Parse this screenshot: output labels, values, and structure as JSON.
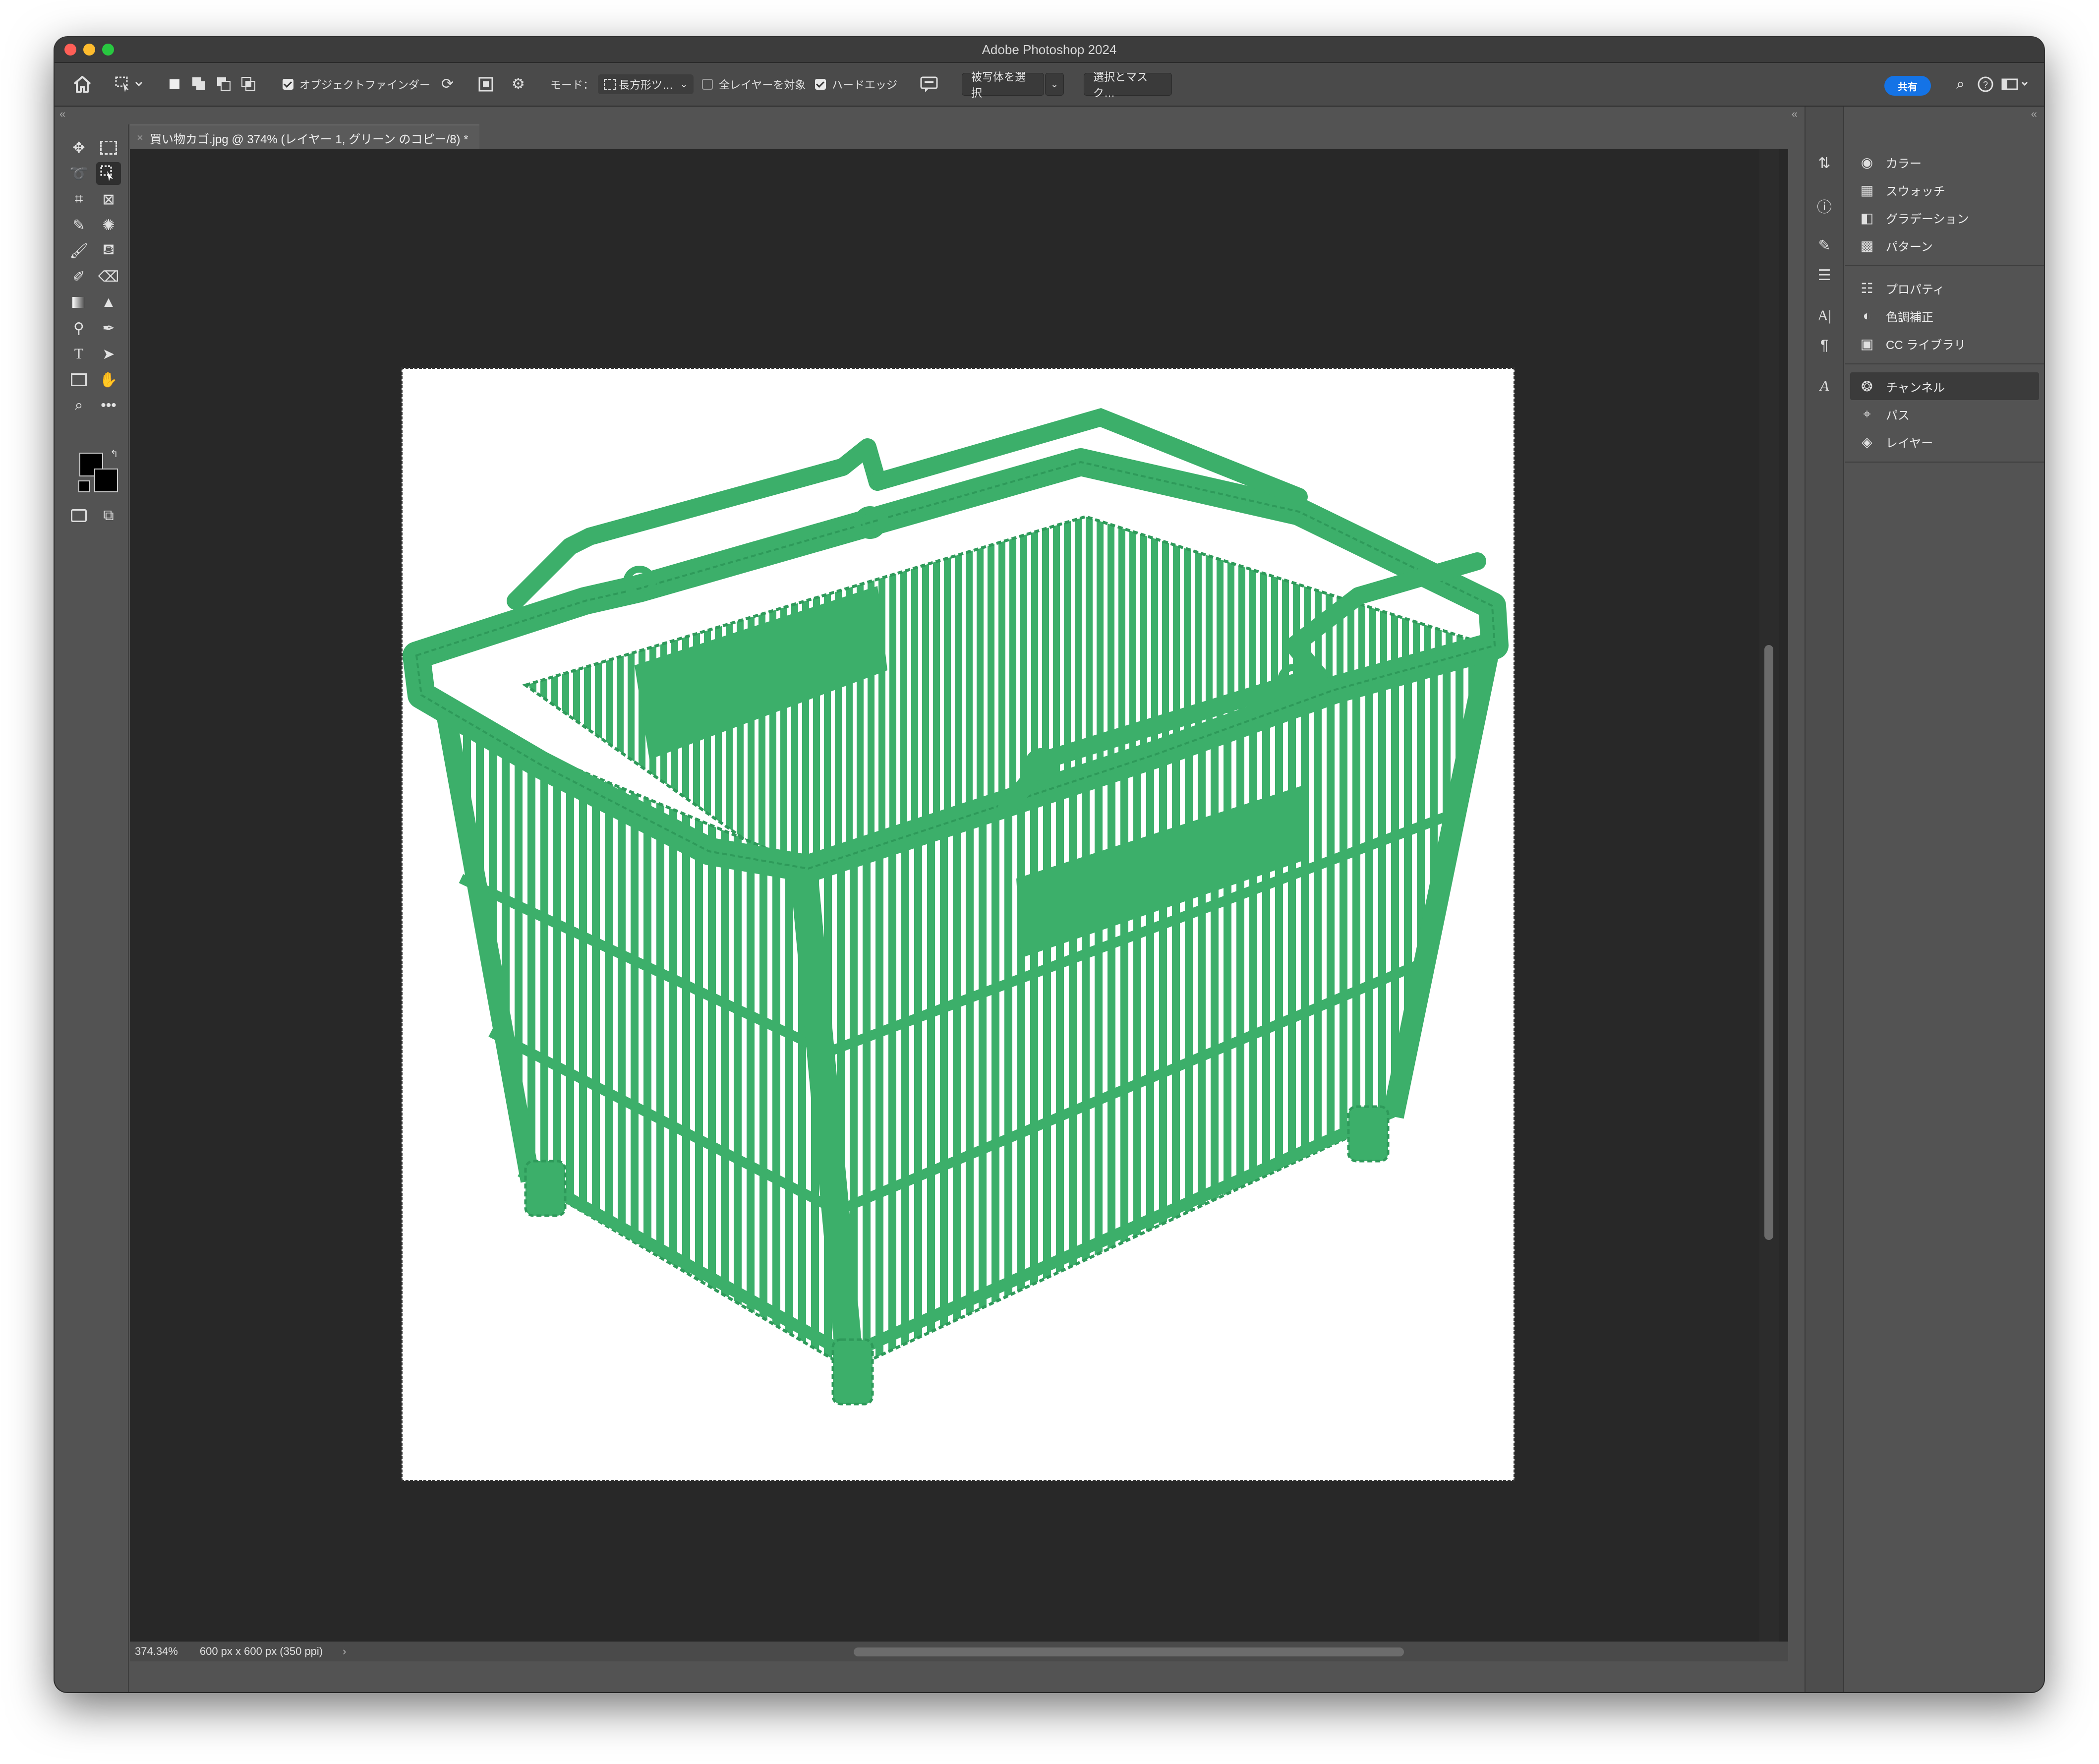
{
  "window": {
    "title": "Adobe Photoshop 2024"
  },
  "options_bar": {
    "object_finder_label": "オブジェクトファインダー",
    "mode_label": "モード：",
    "mode_value": "長方形ツ…",
    "sample_all_layers_label": "全レイヤーを対象",
    "hard_edge_label": "ハードエッジ",
    "select_subject_label": "被写体を選択",
    "select_mask_label": "選択とマスク…",
    "share_label": "共有"
  },
  "document": {
    "tab_title": "買い物カゴ.jpg @ 374% (レイヤー 1, グリーン のコピー/8) *",
    "subject_color": "#3caf6a"
  },
  "status_bar": {
    "zoom": "374.34%",
    "doc_info": "600 px x 600 px (350 ppi)"
  },
  "panels": {
    "group1": [
      {
        "label": "カラー",
        "icon": "color-icon"
      },
      {
        "label": "スウォッチ",
        "icon": "swatches-icon"
      },
      {
        "label": "グラデーション",
        "icon": "gradient-icon"
      },
      {
        "label": "パターン",
        "icon": "pattern-icon"
      }
    ],
    "group2": [
      {
        "label": "プロパティ",
        "icon": "properties-icon"
      },
      {
        "label": "色調補正",
        "icon": "adjustments-icon"
      },
      {
        "label": "CC ライブラリ",
        "icon": "libraries-icon"
      }
    ],
    "group3": [
      {
        "label": "チャンネル",
        "icon": "channels-icon"
      },
      {
        "label": "パス",
        "icon": "paths-icon"
      },
      {
        "label": "レイヤー",
        "icon": "layers-icon"
      }
    ]
  }
}
